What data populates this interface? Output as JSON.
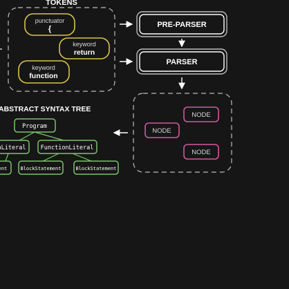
{
  "colors": {
    "background": "#161616",
    "tokens_border": "#d8c64a",
    "node_border": "#d05a9e",
    "ast_border": "#7cc46a",
    "line": "#ffffff"
  },
  "tokens": {
    "title": "TOKENS",
    "items": [
      {
        "type": "punctuator",
        "value": "{"
      },
      {
        "type": "keyword",
        "value": "return"
      },
      {
        "type": "keyword",
        "value": "function"
      }
    ]
  },
  "pipeline": {
    "preparser": "PRE-PARSER",
    "parser": "PARSER"
  },
  "nodes": {
    "items": [
      "NODE",
      "NODE",
      "NODE"
    ]
  },
  "ast": {
    "title": "ABSTRACT SYNTAX TREE",
    "root": "Program",
    "children": [
      "nLiteral",
      "FunctionLiteral"
    ],
    "grandchildren": [
      "ent",
      "BlockStatement",
      "BlockStatement"
    ]
  }
}
